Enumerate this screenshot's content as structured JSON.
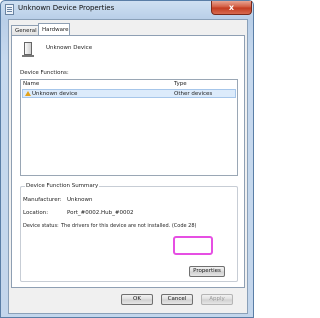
{
  "window": {
    "title": "Unknown Device Properties",
    "close_label": "x"
  },
  "tabs": [
    {
      "label": "General",
      "selected": false
    },
    {
      "label": "Hardware",
      "selected": true
    }
  ],
  "device": {
    "name": "Unknown Device",
    "icon": "device-icon"
  },
  "device_functions": {
    "label": "Device Functions:",
    "columns": [
      "Name",
      "Type"
    ],
    "rows": [
      {
        "name": "Unknown device",
        "type": "Other devices",
        "icon": "warning-icon",
        "selected": true
      }
    ]
  },
  "summary": {
    "title": "Device Function Summary",
    "manufacturer_label": "Manufacturer:",
    "manufacturer_value": "Unknown",
    "location_label": "Location:",
    "location_value": "Port_#0002.Hub_#0002",
    "status_label": "Device status:",
    "status_value": "The drivers for this device are not installed. (Code 28)",
    "properties_button": "Properties"
  },
  "dialog_buttons": {
    "ok": "OK",
    "cancel": "Cancel",
    "apply": "Apply"
  },
  "colors": {
    "highlight": "#e64fe3",
    "selection": "#dcebfb"
  }
}
